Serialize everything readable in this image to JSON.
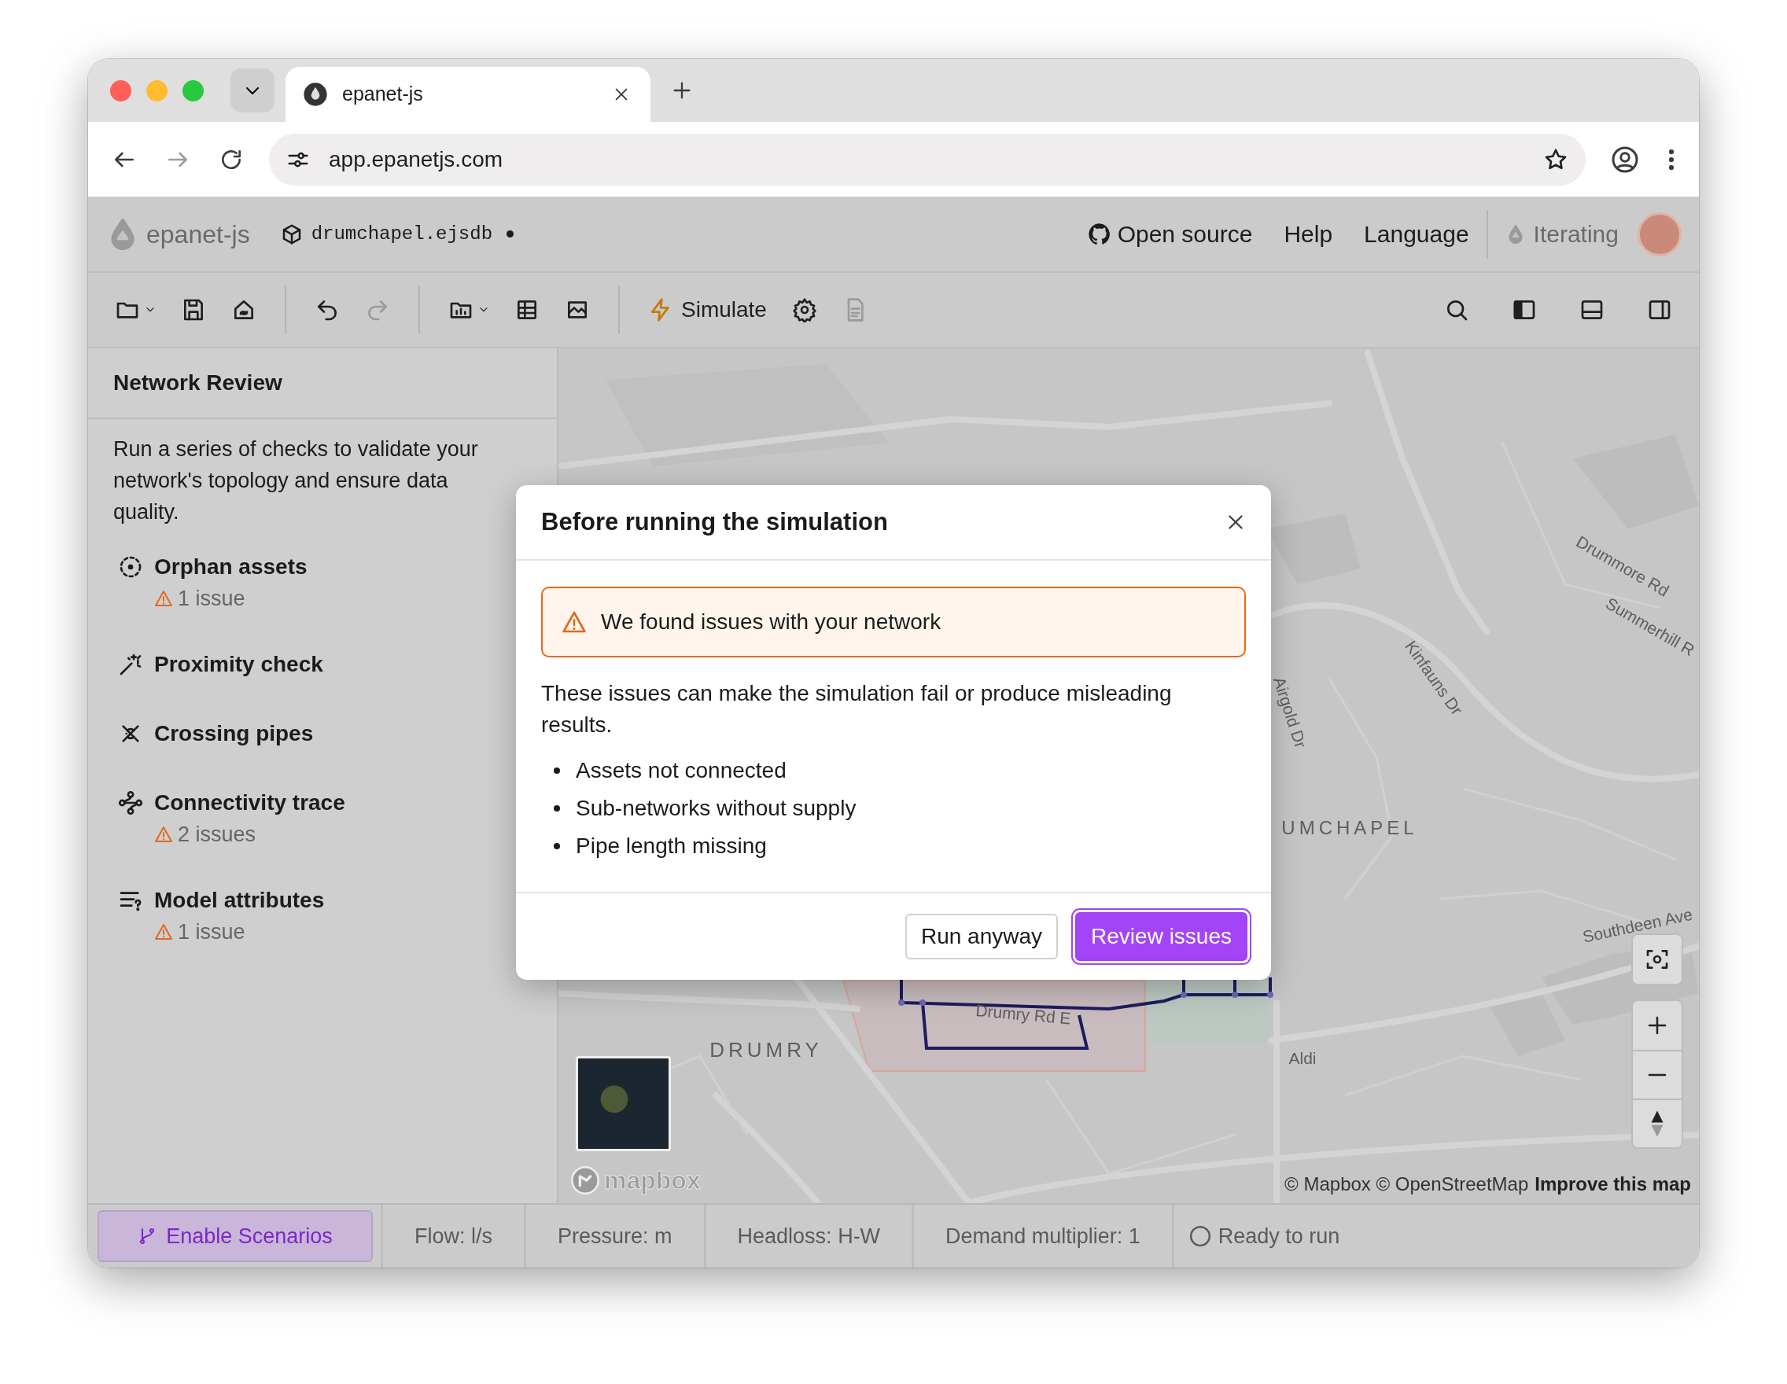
{
  "browser": {
    "tab_title": "epanet-js",
    "url": "app.epanetjs.com"
  },
  "app_header": {
    "brand": "epanet-js",
    "file_name": "drumchapel.ejsdb",
    "unsaved": true,
    "links": [
      "Open source",
      "Help",
      "Language"
    ],
    "plan": "Iterating"
  },
  "toolbar": {
    "groups": [
      [
        {
          "kind": "open",
          "menu": true,
          "disabled": false
        },
        {
          "kind": "save",
          "menu": false,
          "disabled": false
        },
        {
          "kind": "share",
          "menu": false,
          "disabled": false
        }
      ],
      [
        {
          "kind": "undo",
          "menu": false,
          "disabled": false
        },
        {
          "kind": "redo",
          "menu": false,
          "disabled": true
        }
      ],
      [
        {
          "kind": "charts",
          "menu": true,
          "disabled": false
        },
        {
          "kind": "table",
          "menu": false,
          "disabled": false
        },
        {
          "kind": "map-chart",
          "menu": false,
          "disabled": false
        }
      ],
      [
        {
          "kind": "simulate",
          "label": "Simulate",
          "menu": false,
          "disabled": false
        },
        {
          "kind": "settings",
          "menu": false,
          "disabled": false
        },
        {
          "kind": "report",
          "menu": false,
          "disabled": true
        }
      ]
    ],
    "right": [
      {
        "kind": "search",
        "on": false
      },
      {
        "kind": "left-panel",
        "on": true
      },
      {
        "kind": "bottom-panel",
        "on": false
      },
      {
        "kind": "right-panel",
        "on": false
      }
    ]
  },
  "sidebar": {
    "title": "Network Review",
    "description": "Run a series of checks to validate your network's topology and ensure data quality.",
    "checks": [
      {
        "kind": "orphan",
        "label": "Orphan assets",
        "issues": "1 issue"
      },
      {
        "kind": "proximity",
        "label": "Proximity check"
      },
      {
        "kind": "crossing",
        "label": "Crossing pipes"
      },
      {
        "kind": "connectivity",
        "label": "Connectivity trace",
        "issues": "2 issues"
      },
      {
        "kind": "attributes",
        "label": "Model attributes",
        "issues": "1 issue"
      }
    ]
  },
  "map": {
    "labels": [
      "Drummore Rd",
      "Summerhill R",
      "Kinfauns Dr",
      "Airgold Dr",
      "UMCHAPEL",
      "Southdeen Ave",
      "Drumry Rd E",
      "DRUMRY",
      "Aldi"
    ],
    "logo": "mapbox",
    "attribution": "© Mapbox © OpenStreetMap",
    "improve_link": "Improve this map"
  },
  "dialog": {
    "title": "Before running the simulation",
    "alert": "We found issues with your network",
    "message": "These issues can make the simulation fail or produce misleading results.",
    "issues": [
      "Assets not connected",
      "Sub-networks without supply",
      "Pipe length missing"
    ],
    "buttons": [
      {
        "kind": "secondary",
        "label": "Run anyway"
      },
      {
        "kind": "primary",
        "label": "Review issues"
      }
    ]
  },
  "status_bar": {
    "scenarios_button": "Enable Scenarios",
    "items": [
      "Flow: l/s",
      "Pressure: m",
      "Headloss: H-W",
      "Demand multiplier: 1"
    ],
    "run_status": "Ready to run"
  }
}
